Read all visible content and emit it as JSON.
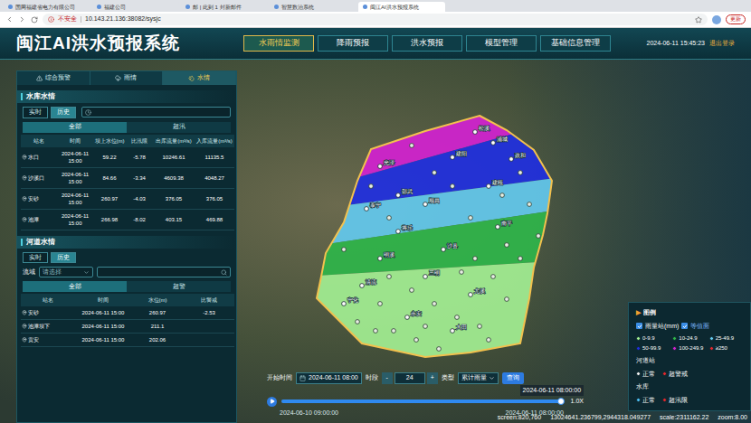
{
  "browser": {
    "tabs": [
      {
        "label": "国网福建省电力有限公司",
        "selected": false
      },
      {
        "label": "福建公司",
        "selected": false
      },
      {
        "label": "邮 | 此到 1 封新邮件",
        "selected": false
      },
      {
        "label": "智慧数治系统",
        "selected": false
      },
      {
        "label": "闽江AI洪水预报系统",
        "selected": true
      }
    ],
    "security": "不安全",
    "url": "10.143.21.136:38082/sysjc",
    "update": "更新"
  },
  "header": {
    "title": "闽江AI洪水预报系统",
    "nav": [
      {
        "label": "水雨情监测",
        "selected": true
      },
      {
        "label": "降雨预报",
        "selected": false
      },
      {
        "label": "洪水预报",
        "selected": false
      },
      {
        "label": "模型管理",
        "selected": false
      },
      {
        "label": "基础信息管理",
        "selected": false
      }
    ],
    "datetime": "2024-06-11 15:45:23",
    "logout": "退出登录"
  },
  "sidebar": {
    "tabs": [
      {
        "label": "综合预警",
        "selected": false
      },
      {
        "label": "雨情",
        "selected": false
      },
      {
        "label": "水情",
        "selected": true
      }
    ],
    "reservoir": {
      "title": "水库水情",
      "mode_tabs": [
        {
          "label": "实时",
          "selected": false
        },
        {
          "label": "历史",
          "selected": true
        }
      ],
      "filter_tabs": [
        {
          "label": "全部",
          "selected": true
        },
        {
          "label": "超汛",
          "selected": false
        }
      ],
      "columns": [
        "站名",
        "时间",
        "坝上水位(m)",
        "比汛限",
        "出库流量(m³/s)",
        "入库流量(m³/s)"
      ],
      "rows": [
        [
          "水口",
          "2024-06-11 15:00",
          "59.22",
          "-5.78",
          "10246.61",
          "11135.5"
        ],
        [
          "沙溪口",
          "2024-06-11 15:00",
          "84.66",
          "-3.34",
          "4609.38",
          "4048.27"
        ],
        [
          "安砂",
          "2024-06-11 15:00",
          "260.97",
          "-4.03",
          "376.05",
          "376.05"
        ],
        [
          "池潭",
          "2024-06-11 15:00",
          "266.98",
          "-8.02",
          "403.15",
          "469.88"
        ]
      ]
    },
    "river": {
      "title": "河道水情",
      "mode_tabs": [
        {
          "label": "实时",
          "selected": false
        },
        {
          "label": "历史",
          "selected": true
        }
      ],
      "basin_label": "流域",
      "basin_placeholder": "请选择",
      "filter_tabs": [
        {
          "label": "全部",
          "selected": true
        },
        {
          "label": "超警",
          "selected": false
        }
      ],
      "columns": [
        "站名",
        "时间",
        "水位(m)",
        "比警戒"
      ],
      "rows": [
        [
          "安砂",
          "2024-06-11 15:00",
          "260.97",
          "-2.53"
        ],
        [
          "池潭坝下",
          "2024-06-11 15:00",
          "211.1",
          ""
        ],
        [
          "贡安",
          "2024-06-11 15:00",
          "202.06",
          ""
        ]
      ]
    }
  },
  "map": {
    "stations": [
      "光泽",
      "邵武",
      "建阳",
      "浦城",
      "松溪",
      "政和",
      "建瓯",
      "顺昌",
      "将乐",
      "泰宁",
      "明溪",
      "沙县",
      "三明",
      "永安",
      "南平",
      "尤溪",
      "大田",
      "清流",
      "宁化"
    ]
  },
  "time_control": {
    "start_label": "开始时间",
    "start_value": "2024-06-11 08:00",
    "period_label": "时段",
    "minus": "-",
    "period_value": "24",
    "plus": "+",
    "type_label": "类型",
    "type_value": "累计雨量",
    "query": "查询",
    "timeline": {
      "start": "2024-06-10 09:00:00",
      "end": "2024-06-11 08:00:00",
      "tooltip": "2024-06-11 08:00:00",
      "speed": "1.0X",
      "level": 1.0
    }
  },
  "legend": {
    "marker": "▶",
    "title": "图例",
    "rain": {
      "label": "雨量站(mm)",
      "checked": true
    },
    "isosurface": {
      "label": "等值面",
      "checked": true
    },
    "ranges": [
      {
        "label": "0-9.9",
        "color": "#a3ef92"
      },
      {
        "label": "10-24.9",
        "color": "#2fb54a"
      },
      {
        "label": "25-49.9",
        "color": "#63c9ee"
      },
      {
        "label": "50-99.9",
        "color": "#1f2fe0"
      },
      {
        "label": "100-249.9",
        "color": "#d322d0"
      },
      {
        "label": "≥250",
        "color": "#e5262b"
      }
    ],
    "river": {
      "title": "河道站",
      "items": [
        {
          "label": "正常",
          "color": "#f2f2f2"
        },
        {
          "label": "超警戒",
          "color": "#e5262b"
        }
      ]
    },
    "reservoir": {
      "title": "水库",
      "items": [
        {
          "label": "正常",
          "color": "#4fc3f7"
        },
        {
          "label": "超汛限",
          "color": "#e5262b"
        }
      ]
    }
  },
  "status_bar": [
    "screen:820,760",
    "13024641.236799,2944318.049277",
    "scale:2311162.22",
    "zoom:8.00"
  ]
}
